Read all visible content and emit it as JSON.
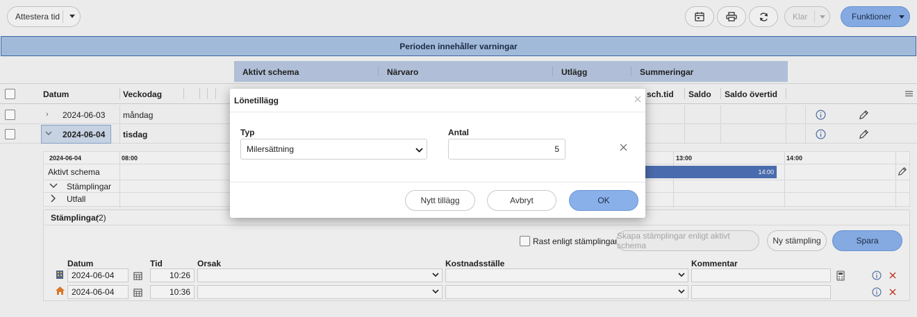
{
  "toolbar": {
    "attestera_label": "Attestera tid",
    "klar_label": "Klar",
    "funktioner_label": "Funktioner"
  },
  "banner": {
    "text": "Perioden innehåller varningar"
  },
  "groups": {
    "aktivt_schema": "Aktivt schema",
    "narvaro": "Närvaro",
    "utlagg": "Utlägg",
    "summeringar": "Summeringar"
  },
  "columns": {
    "datum": "Datum",
    "veckodag": "Veckodag",
    "sch_tid": "sch.tid",
    "saldo": "Saldo",
    "saldo_overtid": "Saldo övertid"
  },
  "rows": [
    {
      "datum": "2024-06-03",
      "veckodag": "måndag"
    },
    {
      "datum": "2024-06-04",
      "veckodag": "tisdag"
    }
  ],
  "timeline": {
    "date": "2024-06-04",
    "ticks": [
      "08:00",
      "13:00",
      "14:00"
    ],
    "aktivt_schema": "Aktivt schema",
    "stamplingar": "Stämplingar",
    "utfall": "Utfall",
    "bar_end": "14:00"
  },
  "stamp_panel": {
    "title": "Stämplingar",
    "count": "(2)",
    "rast_label": "Rast enligt stämplingar",
    "skapa_label": "Skapa stämplingar enligt aktivt schema",
    "ny_label": "Ny stämpling",
    "spara_label": "Spara",
    "headers": {
      "datum": "Datum",
      "tid": "Tid",
      "orsak": "Orsak",
      "kostnadsstalle": "Kostnadsställe",
      "kommentar": "Kommentar"
    },
    "entries": [
      {
        "datum": "2024-06-04",
        "tid": "10:26"
      },
      {
        "datum": "2024-06-04",
        "tid": "10:36"
      }
    ]
  },
  "modal": {
    "title": "Lönetillägg",
    "typ_label": "Typ",
    "typ_value": "Milersättning",
    "antal_label": "Antal",
    "antal_value": "5",
    "nytt_label": "Nytt tillägg",
    "avbryt_label": "Avbryt",
    "ok_label": "OK"
  },
  "colors": {
    "accent": "#8ab0ea",
    "banner": "#a8c0e2",
    "schedule_bar": "#4d6fb3"
  }
}
